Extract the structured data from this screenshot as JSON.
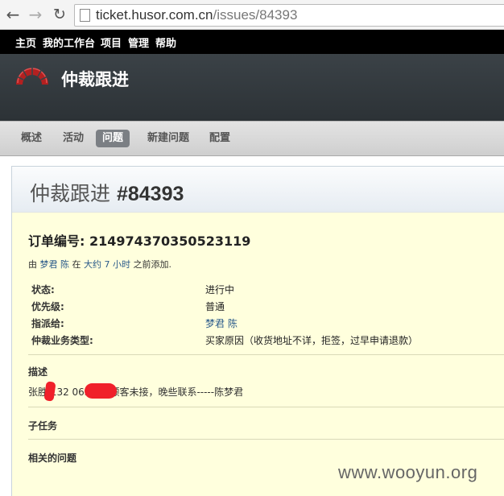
{
  "browser": {
    "url_host": "ticket.husor.com.cn",
    "url_path": "/issues/84393",
    "icons": [
      "back-arrow-icon",
      "forward-arrow-icon",
      "reload-icon",
      "page-icon"
    ]
  },
  "top_menu": {
    "items": [
      "主页",
      "我的工作台",
      "项目",
      "管理",
      "帮助"
    ]
  },
  "header": {
    "project_title": "仲裁跟进"
  },
  "main_menu": {
    "tabs": [
      "概述",
      "活动",
      "问题",
      "新建问题",
      "配置"
    ],
    "selected": "问题"
  },
  "issue": {
    "tracker": "仲裁跟进",
    "number": "#84393",
    "subject": "订单编号: 214974370350523119",
    "author_prefix": "由",
    "author_name": "梦君 陈",
    "author_mid": "在",
    "author_time": "大约 7 小时",
    "author_suffix": "之前添加.",
    "attributes": [
      {
        "label": "状态:",
        "value": "进行中"
      },
      {
        "label": "优先级:",
        "value": "普通"
      },
      {
        "label": "指派给:",
        "value": "梦君 陈"
      },
      {
        "label": "仲裁业务类型:",
        "value": "买家原因（收货地址不详，拒签，过早申请退款）"
      }
    ],
    "description_title": "描述",
    "description_text": "张胜  132        063电联顾客未接，晚些联系-----陈梦君",
    "subtasks_title": "子任务",
    "related_title": "相关的问题"
  },
  "watermark": "www.wooyun.org",
  "colors": {
    "top_menu_bg": "#000000",
    "header_bg": "#2c3236",
    "selected_tab_bg": "#7b7f84",
    "issue_bg": "#ffffdd",
    "link": "#2a5a8a",
    "redaction": "#f0202a"
  }
}
